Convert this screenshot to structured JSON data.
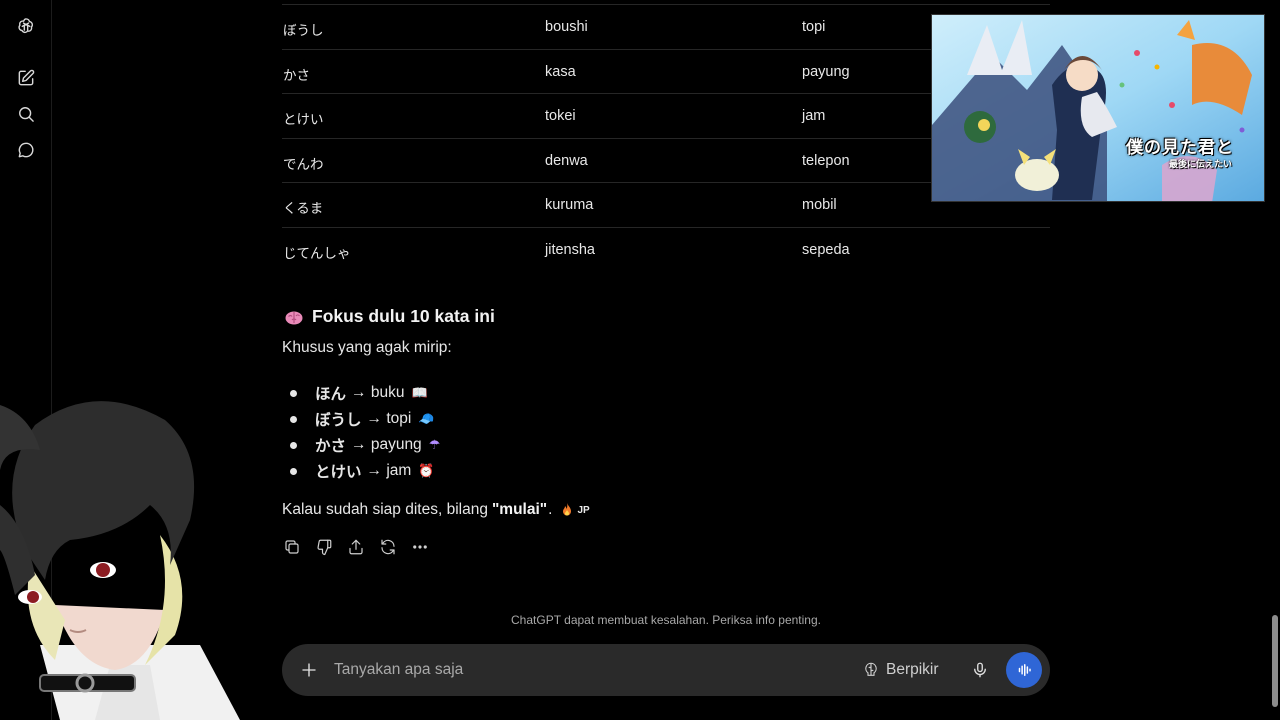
{
  "vocab_rows": [
    {
      "jp": "ぼうし",
      "romaji": "boushi",
      "meaning": "topi"
    },
    {
      "jp": "かさ",
      "romaji": "kasa",
      "meaning": "payung"
    },
    {
      "jp": "とけい",
      "romaji": "tokei",
      "meaning": "jam"
    },
    {
      "jp": "でんわ",
      "romaji": "denwa",
      "meaning": "telepon"
    },
    {
      "jp": "くるま",
      "romaji": "kuruma",
      "meaning": "mobil"
    },
    {
      "jp": "じてんしゃ",
      "romaji": "jitensha",
      "meaning": "sepeda"
    }
  ],
  "focus": {
    "title": "Fokus dulu 10 kata ini",
    "intro": "Khusus yang agak mirip:",
    "items": [
      {
        "jp": "ほん",
        "arrow": "→",
        "meaning": "buku",
        "emoji": "📖"
      },
      {
        "jp": "ぼうし",
        "arrow": "→",
        "meaning": "topi",
        "emoji": "🧢"
      },
      {
        "jp": "かさ",
        "arrow": "→",
        "meaning": "payung",
        "emoji": "☂"
      },
      {
        "jp": "とけい",
        "arrow": "→",
        "meaning": "jam",
        "emoji": "⏰"
      }
    ],
    "closing_prefix": "Kalau sudah siap dites, bilang",
    "closing_bold": "\"mulai\"",
    "closing_suffix": ".",
    "badge": "JP"
  },
  "disclaimer": "ChatGPT dapat membuat kesalahan. Periksa info penting.",
  "composer": {
    "placeholder": "Tanyakan apa saja",
    "think_label": "Berpikir"
  },
  "video": {
    "title": "僕の見た君と",
    "subtitle": "最後に伝えたい"
  },
  "icons": {
    "rail": [
      "openai-logo-icon",
      "new-chat-icon",
      "search-icon",
      "chat-bubble-icon"
    ],
    "actions": [
      "copy-icon",
      "thumbs-down-icon",
      "share-icon",
      "regenerate-icon",
      "more-icon"
    ]
  },
  "colors": {
    "background": "#000000",
    "composer": "#2a2a2a",
    "voice_button": "#2f66d6"
  }
}
